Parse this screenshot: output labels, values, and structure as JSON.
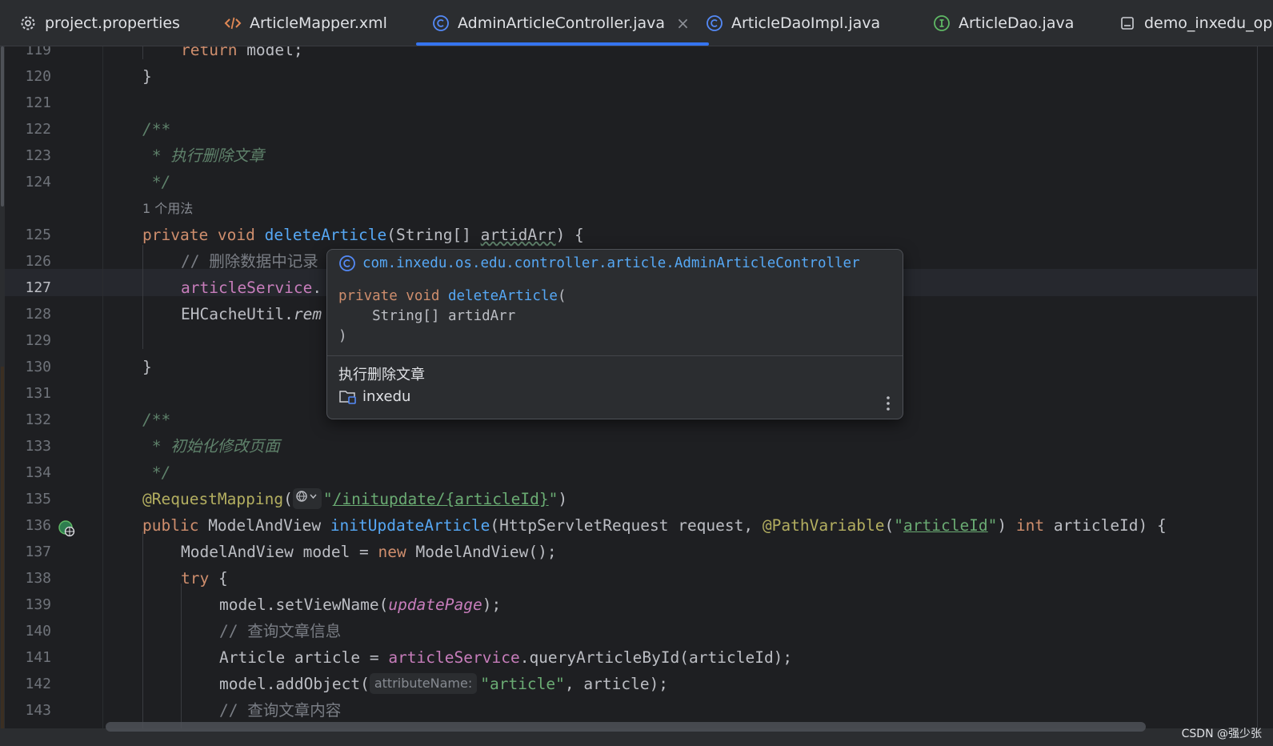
{
  "tabs": [
    {
      "label": "project.properties",
      "icon": "gear-icon"
    },
    {
      "label": "ArticleMapper.xml",
      "icon": "xml-icon"
    },
    {
      "label": "AdminArticleController.java",
      "icon": "class-icon",
      "active": true
    },
    {
      "label": "ArticleDaoImpl.java",
      "icon": "class-icon"
    },
    {
      "label": "ArticleDao.java",
      "icon": "interface-icon"
    },
    {
      "label": "demo_inxedu_ope",
      "icon": "file-icon"
    }
  ],
  "close_glyph": "×",
  "line_numbers": [
    "119",
    "120",
    "121",
    "122",
    "123",
    "124",
    "125",
    "126",
    "127",
    "128",
    "129",
    "130",
    "131",
    "132",
    "133",
    "134",
    "135",
    "136",
    "137",
    "138",
    "139",
    "140",
    "141",
    "142",
    "143"
  ],
  "current_line": "127",
  "usage_hint": "1 个用法",
  "code": {
    "l119_kw": "return",
    "l119_rest": " model;",
    "brace_close": "}",
    "doc_open": "/**",
    "l123_doc": " * 执行删除文章",
    "doc_close": " */",
    "l125_kw": "private void ",
    "l125_fn": "deleteArticle",
    "l125_a": "(String[] ",
    "l125_param": "artidArr",
    "l125_b": ") {",
    "l126_cm": "// 删除数据中记录",
    "l127_field": "articleService",
    "l127_rest": ".",
    "l128_a": "EHCacheUtil.",
    "l128_it": "rem",
    "l133_doc": " * 初始化修改页面",
    "l135_ann": "@RequestMapping",
    "l135_a": "(",
    "l135_q1": "\"",
    "l135_url": "/initupdate/{articleId}",
    "l135_q2": "\"",
    "l135_b": ")",
    "l136_kw": "public ",
    "l136_a": "ModelAndView ",
    "l136_fn": "initUpdateArticle",
    "l136_b": "(HttpServletRequest request, ",
    "l136_ann": "@PathVariable",
    "l136_c": "(",
    "l136_q1": "\"",
    "l136_str": "articleId",
    "l136_q2": "\"",
    "l136_d": ") ",
    "l136_kw2": "int",
    "l136_e": " articleId) {",
    "l137_a": "ModelAndView model = ",
    "l137_kw": "new",
    "l137_b": " ModelAndView();",
    "l138_kw": "try",
    "l138_b": " {",
    "l139_a": "model.setViewName(",
    "l139_it": "updatePage",
    "l139_b": ");",
    "l140_cm": "// 查询文章信息",
    "l141_a": "Article article = ",
    "l141_field": "articleService",
    "l141_b": ".queryArticleById(articleId);",
    "l142_a": "model.addObject(",
    "l142_inlay": "attributeName:",
    "l142_str": "\"article\"",
    "l142_b": ", article);",
    "l143_cm": "// 查询文章内容"
  },
  "popup": {
    "fqcn": "com.inxedu.os.edu.controller.article.AdminArticleController",
    "sig_kw": "private void ",
    "sig_fn": "deleteArticle",
    "sig_open": "(",
    "sig_param": "    String[] artidArr",
    "sig_close": ")",
    "description": "执行删除文章",
    "module": "inxedu"
  },
  "watermark": "CSDN @强少张",
  "colors": {
    "accent": "#3574f0",
    "keyword": "#cf8e6d",
    "function": "#56a8f5",
    "string": "#6aab73",
    "annotation": "#b3ae60",
    "field": "#c77dbb"
  }
}
